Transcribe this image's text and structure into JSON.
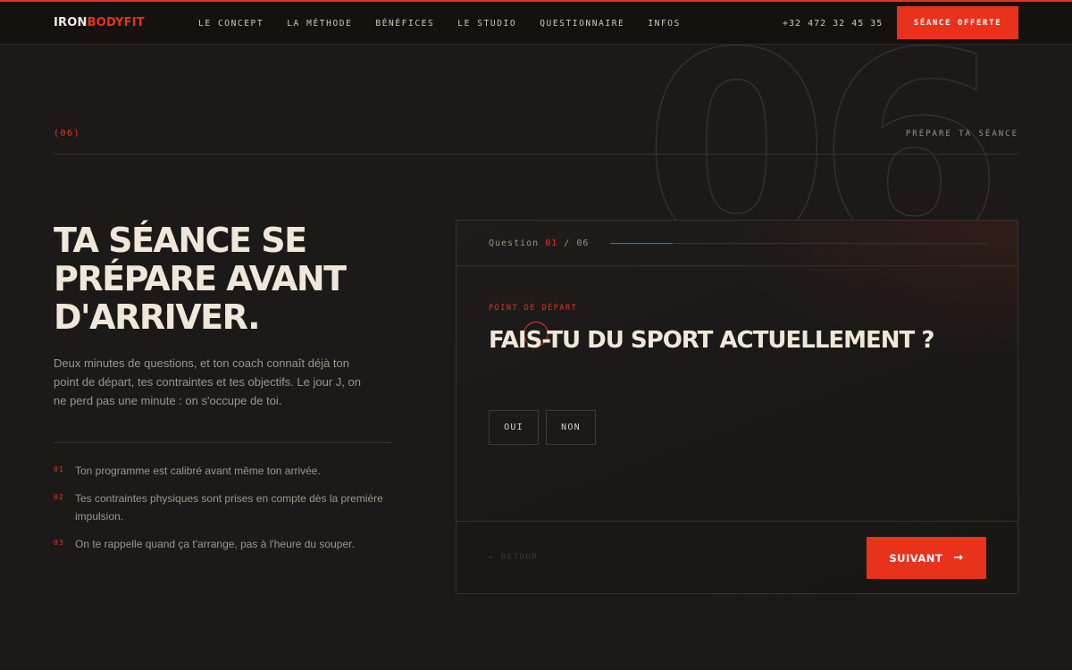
{
  "brand": {
    "part1": "IRON",
    "part2": "BODYFIT"
  },
  "nav": [
    "LE CONCEPT",
    "LA MÉTHODE",
    "BÉNÉFICES",
    "LE STUDIO",
    "QUESTIONNAIRE",
    "INFOS"
  ],
  "header": {
    "phone": "+32 472 32 45 35",
    "cta": "SÉANCE OFFERTE"
  },
  "section": {
    "number": "(06)",
    "label": "PRÉPARE TA SÉANCE",
    "watermark": "06"
  },
  "hero": {
    "title": "TA SÉANCE SE PRÉPARE AVANT D'ARRIVER.",
    "lead": "Deux minutes de questions, et ton coach connaît déjà ton point de départ, tes contraintes et tes objectifs. Le jour J, on ne perd pas une minute : on s'occupe de toi."
  },
  "points": [
    {
      "num": "01",
      "text": "Ton programme est calibré avant même ton arrivée."
    },
    {
      "num": "02",
      "text": "Tes contraintes physiques sont prises en compte dès la première impulsion."
    },
    {
      "num": "03",
      "text": "On te rappelle quand ça t'arrange, pas à l'heure du souper."
    }
  ],
  "quiz": {
    "question_label": "Question",
    "current": "01",
    "separator": "/",
    "total": "06",
    "progress_fraction": 0.1667,
    "tag": "POINT DE DÉPART",
    "question": "FAIS-TU DU SPORT ACTUELLEMENT ?",
    "answers": [
      "OUI",
      "NON"
    ],
    "back_label": "← RETOUR",
    "next_label": "SUIVANT",
    "next_icon": "arrow-right-icon"
  },
  "colors": {
    "accent": "#e8321c",
    "background": "#1c1a18",
    "text": "#ece4d6"
  }
}
